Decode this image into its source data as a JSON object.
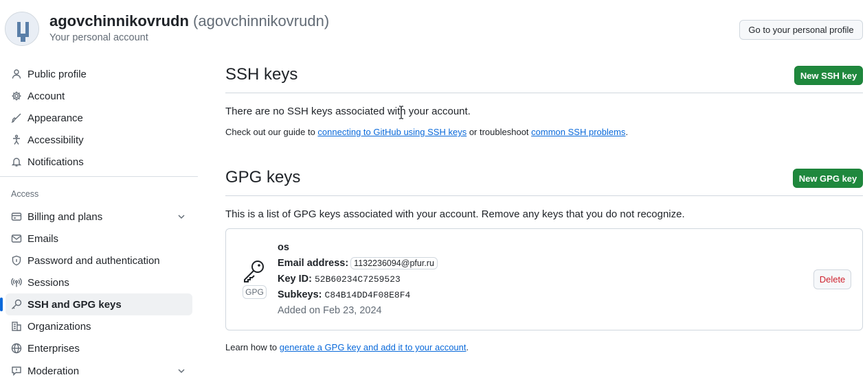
{
  "header": {
    "account_name": "agovchinnikovrudn",
    "account_login": "(agovchinnikovrudn)",
    "subtitle": "Your personal account",
    "profile_button": "Go to your personal profile"
  },
  "sidebar": {
    "items": [
      {
        "label": "Public profile",
        "icon": "person-icon"
      },
      {
        "label": "Account",
        "icon": "gear-icon"
      },
      {
        "label": "Appearance",
        "icon": "paintbrush-icon"
      },
      {
        "label": "Accessibility",
        "icon": "accessibility-icon"
      },
      {
        "label": "Notifications",
        "icon": "bell-icon"
      }
    ],
    "section_label": "Access",
    "access_items": [
      {
        "label": "Billing and plans",
        "icon": "credit-card-icon",
        "expandable": true
      },
      {
        "label": "Emails",
        "icon": "mail-icon"
      },
      {
        "label": "Password and authentication",
        "icon": "shield-lock-icon"
      },
      {
        "label": "Sessions",
        "icon": "broadcast-icon"
      },
      {
        "label": "SSH and GPG keys",
        "icon": "key-icon",
        "active": true
      },
      {
        "label": "Organizations",
        "icon": "organization-icon"
      },
      {
        "label": "Enterprises",
        "icon": "globe-icon"
      },
      {
        "label": "Moderation",
        "icon": "report-icon",
        "expandable": true
      }
    ]
  },
  "ssh": {
    "title": "SSH keys",
    "new_button": "New SSH key",
    "empty_text": "There are no SSH keys associated with your account.",
    "guide_prefix": "Check out our guide to ",
    "guide_link": "connecting to GitHub using SSH keys",
    "guide_middle": " or troubleshoot ",
    "troubleshoot_link": "common SSH problems",
    "guide_suffix": "."
  },
  "gpg": {
    "title": "GPG keys",
    "new_button": "New GPG key",
    "description": "This is a list of GPG keys associated with your account. Remove any keys that you do not recognize.",
    "key": {
      "badge": "GPG",
      "name": "os",
      "email_label": "Email address:",
      "email": "1132236094@pfur.ru",
      "key_id_label": "Key ID:",
      "key_id": "52B60234C7259523",
      "subkeys_label": "Subkeys:",
      "subkeys": "C84B14DD4F08E8F4",
      "added": "Added on Feb 23, 2024",
      "delete_button": "Delete"
    },
    "learn_prefix": "Learn how to ",
    "learn_link": "generate a GPG key and add it to your account",
    "learn_suffix": "."
  },
  "colors": {
    "accent": "#0969da",
    "primary_button": "#1f883d",
    "danger": "#cf222e",
    "text": "#1f2328",
    "muted": "#636c76",
    "border": "#d0d7de"
  }
}
